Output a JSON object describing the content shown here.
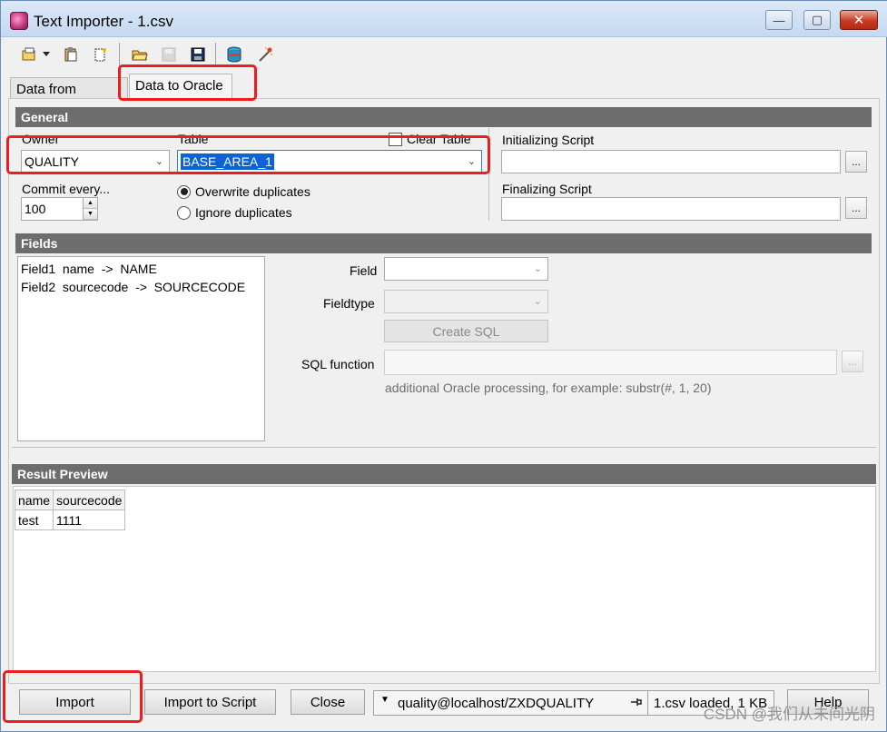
{
  "window": {
    "title": "Text Importer - 1.csv",
    "minimize": "—",
    "maximize": "▢",
    "close": "✕"
  },
  "toolbar": {
    "icons": [
      "open-wizard-icon",
      "dropdown-arrow-icon",
      "paste-icon",
      "clear-icon",
      "open-folder-icon",
      "save-disabled-icon",
      "save-icon",
      "database-icon",
      "magic-wand-icon"
    ]
  },
  "tabs": {
    "tab1": "Data from Textfile",
    "tab2": "Data to Oracle"
  },
  "general": {
    "header": "General",
    "owner_label": "Owner",
    "owner_value": "QUALITY",
    "table_label": "Table",
    "table_value": "BASE_AREA_1",
    "clear_table_label": "Clear Table",
    "init_script_label": "Initializing Script",
    "final_script_label": "Finalizing Script",
    "commit_label": "Commit every...",
    "commit_value": "100",
    "overwrite_label": "Overwrite duplicates",
    "ignore_label": "Ignore duplicates",
    "dots": "..."
  },
  "fields": {
    "header": "Fields",
    "list": [
      "Field1  name  ->  NAME",
      "Field2  sourcecode  ->  SOURCECODE"
    ],
    "field_label": "Field",
    "fieldtype_label": "Fieldtype",
    "create_sql_label": "Create SQL",
    "sql_function_label": "SQL function",
    "hint": "additional Oracle processing, for example: substr(#, 1, 20)"
  },
  "result_preview": {
    "header": "Result Preview",
    "columns": [
      "name",
      "sourcecode"
    ],
    "rows": [
      [
        "test",
        "1111"
      ]
    ]
  },
  "bottom": {
    "import_label": "Import",
    "import_script_label": "Import to Script",
    "close_label": "Close",
    "connection": "quality@localhost/ZXDQUALITY",
    "status": "1.csv loaded, 1 KB",
    "help_label": "Help"
  },
  "watermark": "CSDN @我们从未间光阴"
}
